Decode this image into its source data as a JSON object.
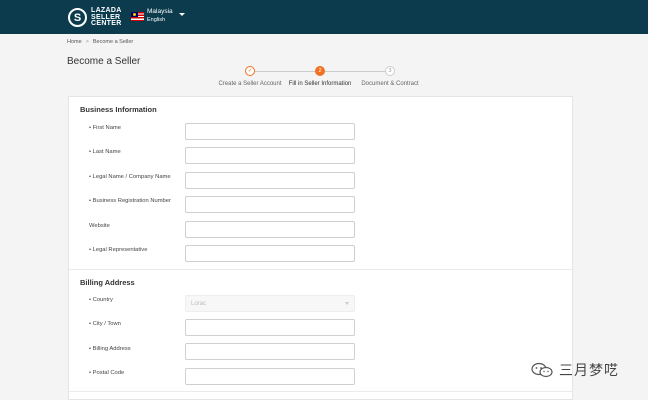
{
  "header": {
    "logo_mark": "S",
    "logo_lines": [
      "LAZADA",
      "SELLER",
      "CENTER"
    ],
    "region_country": "Malaysia",
    "region_language": "English"
  },
  "breadcrumb": {
    "home": "Home",
    "separator": ">",
    "current": "Become a Seller"
  },
  "page_title": "Become a Seller",
  "steps": [
    {
      "number": "✓",
      "label": "Create a Seller Account",
      "state": "done"
    },
    {
      "number": "2",
      "label": "Fill in Seller Information",
      "state": "active"
    },
    {
      "number": "3",
      "label": "Document & Contract",
      "state": "todo"
    }
  ],
  "business_section": {
    "title": "Business Information",
    "fields": [
      {
        "label": "• First Name",
        "value": ""
      },
      {
        "label": "• Last Name",
        "value": ""
      },
      {
        "label": "• Legal Name / Company Name",
        "value": ""
      },
      {
        "label": "• Business Registration Number",
        "value": ""
      },
      {
        "label": "Website",
        "value": ""
      },
      {
        "label": "• Legal Representative",
        "value": ""
      }
    ]
  },
  "billing_section": {
    "title": "Billing Address",
    "country_label": "• Country",
    "country_value": "Lorac",
    "fields": [
      {
        "label": "• City / Town",
        "value": ""
      },
      {
        "label": "• Billing Address",
        "value": ""
      },
      {
        "label": "• Postal Code",
        "value": ""
      }
    ]
  },
  "watermark": {
    "text": "三月梦呓"
  },
  "colors": {
    "header_bg": "#0b3b4d",
    "accent": "#f36f21"
  }
}
